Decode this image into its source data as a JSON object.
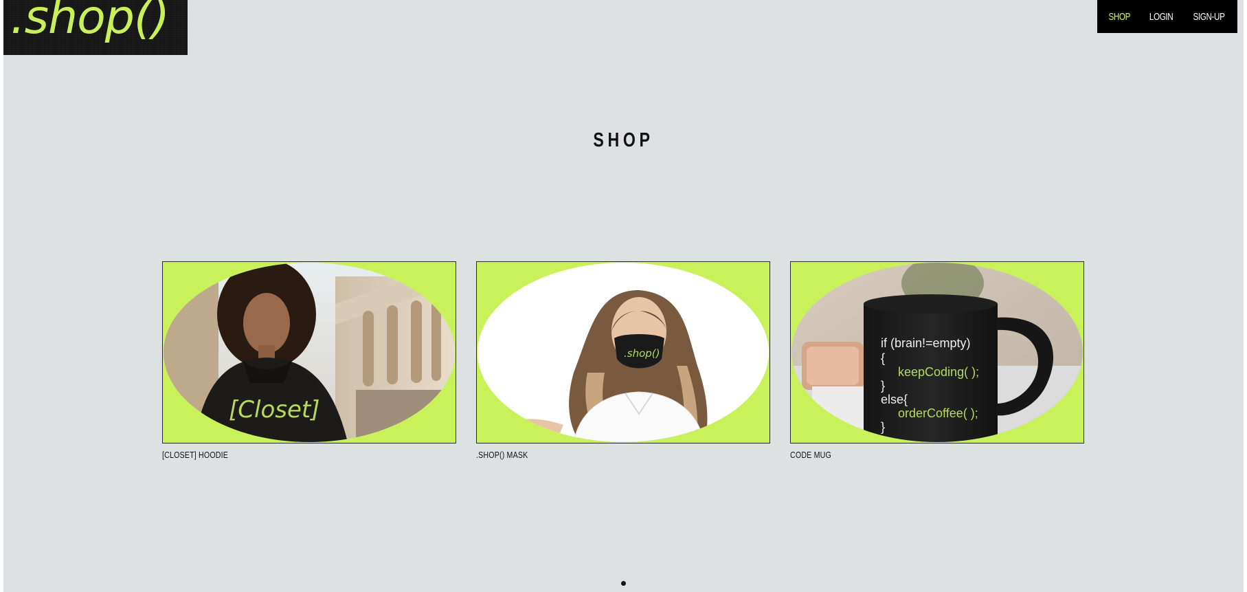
{
  "header": {
    "logo_text": ".shop()",
    "nav": {
      "shop_label": "SHOP",
      "login_label": "LOGIN",
      "signup_label": "SIGN-UP"
    }
  },
  "main": {
    "title": "SHOP",
    "products": [
      {
        "name": "[CLOSET] HOODIE",
        "print_text": "[Closet]"
      },
      {
        "name": ".SHOP() MASK",
        "print_text": ".shop()"
      },
      {
        "name": "CODE MUG",
        "print_lines": [
          "if (brain!=empty)",
          "{",
          "keepCoding( );",
          "}",
          "else{",
          "orderCoffee( );",
          "}"
        ]
      }
    ]
  },
  "carousel": {
    "active_index": 1
  },
  "colors": {
    "page_bg": "#dde1e2",
    "accent_lime": "#c9f25a",
    "nav_bg": "#000000",
    "nav_active": "#d6f56e"
  }
}
